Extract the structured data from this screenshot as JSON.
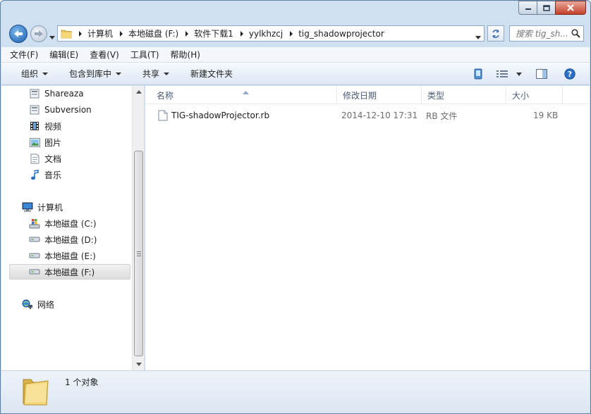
{
  "address": {
    "crumbs": [
      "计算机",
      "本地磁盘 (F:)",
      "软件下载1",
      "yylkhzcj",
      "tig_shadowprojector"
    ]
  },
  "search": {
    "placeholder": "搜索 tig_sh..."
  },
  "menu": [
    "文件(F)",
    "编辑(E)",
    "查看(V)",
    "工具(T)",
    "帮助(H)"
  ],
  "toolbar": {
    "organize": "组织",
    "include_library": "包含到库中",
    "share": "共享",
    "new_folder": "新建文件夹"
  },
  "nav": {
    "items": [
      {
        "label": "Shareaza",
        "icon": "library-icon"
      },
      {
        "label": "Subversion",
        "icon": "library-icon"
      },
      {
        "label": "视频",
        "icon": "video-library-icon"
      },
      {
        "label": "图片",
        "icon": "pictures-library-icon"
      },
      {
        "label": "文档",
        "icon": "documents-library-icon"
      },
      {
        "label": "音乐",
        "icon": "music-library-icon"
      },
      {
        "label": "计算机",
        "icon": "computer-icon"
      },
      {
        "label": "本地磁盘 (C:)",
        "icon": "system-drive-icon"
      },
      {
        "label": "本地磁盘 (D:)",
        "icon": "drive-icon"
      },
      {
        "label": "本地磁盘 (E:)",
        "icon": "drive-icon"
      },
      {
        "label": "本地磁盘 (F:)",
        "icon": "drive-icon"
      },
      {
        "label": "网络",
        "icon": "network-icon"
      }
    ]
  },
  "columns": {
    "name": "名称",
    "modified": "修改日期",
    "type": "类型",
    "size": "大小"
  },
  "files": [
    {
      "name": "TIG-shadowProjector.rb",
      "modified": "2014-12-10 17:31",
      "type": "RB 文件",
      "size": "19 KB"
    }
  ],
  "status": {
    "count": "1 个对象"
  },
  "colors": {
    "frame": "#cfe0f1",
    "accent": "#1c5fae",
    "close": "#c6402b"
  }
}
